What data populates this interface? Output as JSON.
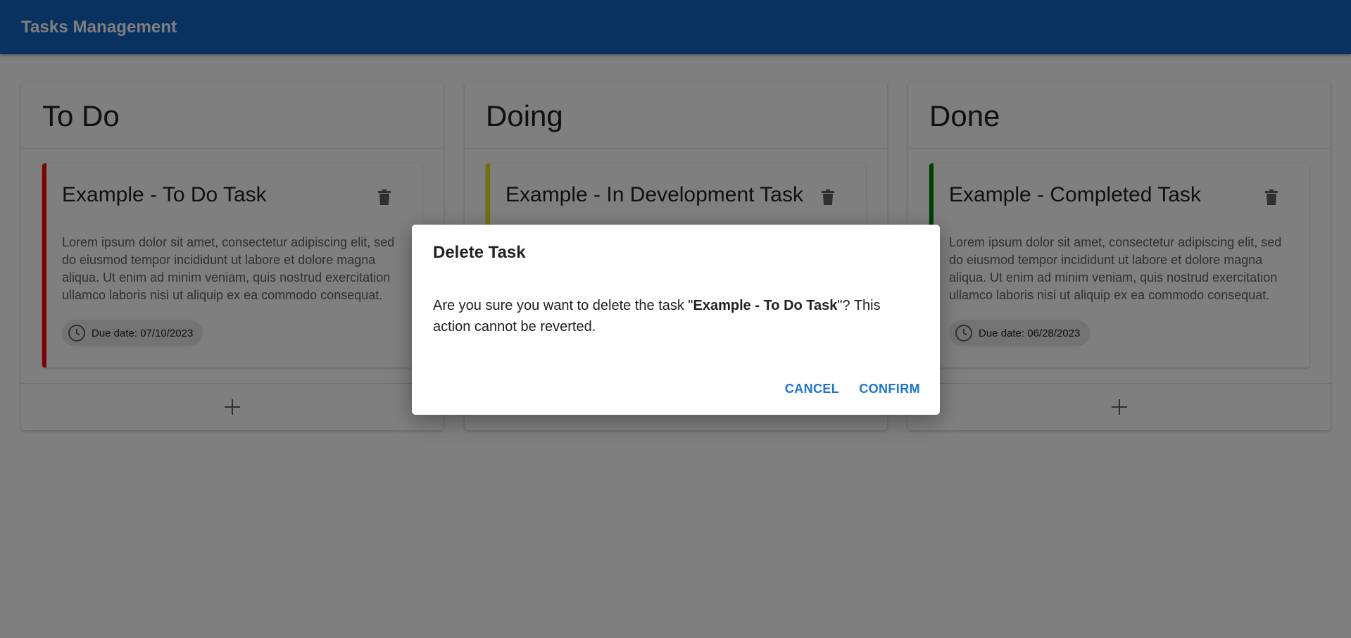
{
  "app": {
    "title": "Tasks Management"
  },
  "colors": {
    "appbar": "#1565c0",
    "todo_accent": "#ff0000",
    "doing_accent": "#e4e400",
    "done_accent": "#008000",
    "dialog_button": "#1976d2"
  },
  "columns": [
    {
      "title": "To Do",
      "task": {
        "title": "Example - To Do Task",
        "description": "Lorem ipsum dolor sit amet, consectetur adipiscing elit, sed do eiusmod tempor incididunt ut labore et dolore magna aliqua. Ut enim ad minim veniam, quis nostrud exercitation ullamco laboris nisi ut aliquip ex ea commodo consequat.",
        "due_date": "Due date: 07/10/2023"
      }
    },
    {
      "title": "Doing",
      "task": {
        "title": "Example - In Development Task"
      }
    },
    {
      "title": "Done",
      "task": {
        "title": "Example - Completed Task",
        "description": "Lorem ipsum dolor sit amet, consectetur adipiscing elit, sed do eiusmod tempor incididunt ut labore et dolore magna aliqua. Ut enim ad minim veniam, quis nostrud exercitation ullamco laboris nisi ut aliquip ex ea commodo consequat.",
        "due_date": "Due date: 06/28/2023"
      }
    }
  ],
  "icons": {
    "delete": "trash-icon",
    "add": "plus-icon",
    "due": "clock-icon"
  },
  "dialog": {
    "title": "Delete Task",
    "message_before": "Are you sure you want to delete the task \"",
    "task_name": "Example - To Do Task",
    "message_after": "\"? This action cannot be reverted.",
    "cancel_label": "CANCEL",
    "confirm_label": "CONFIRM"
  }
}
